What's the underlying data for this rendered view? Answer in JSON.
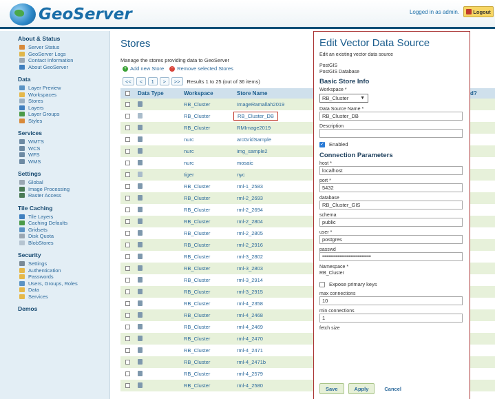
{
  "header": {
    "logo_text": "GeoServer",
    "login_info": "Logged in as admin.",
    "logout_label": "Logout"
  },
  "sidebar": {
    "sections": [
      {
        "title": "About & Status",
        "items": [
          {
            "label": "Server Status",
            "icon": "server-icon",
            "color": "#d88a3a"
          },
          {
            "label": "GeoServer Logs",
            "icon": "logs-icon",
            "color": "#e0b64a"
          },
          {
            "label": "Contact Information",
            "icon": "contact-icon",
            "color": "#9aa7b3"
          },
          {
            "label": "About GeoServer",
            "icon": "info-icon",
            "color": "#3f7fbf"
          }
        ]
      },
      {
        "title": "Data",
        "items": [
          {
            "label": "Layer Preview",
            "icon": "preview-icon",
            "color": "#5a93c4"
          },
          {
            "label": "Workspaces",
            "icon": "folder-icon",
            "color": "#e5b84a"
          },
          {
            "label": "Stores",
            "icon": "store-icon",
            "color": "#9ab0c2"
          },
          {
            "label": "Layers",
            "icon": "layers-icon",
            "color": "#3f7fbf"
          },
          {
            "label": "Layer Groups",
            "icon": "layer-groups-icon",
            "color": "#4a9a48"
          },
          {
            "label": "Styles",
            "icon": "styles-icon",
            "color": "#d88a3a"
          }
        ]
      },
      {
        "title": "Services",
        "items": [
          {
            "label": "WMTS",
            "icon": "wmts-icon",
            "color": "#6d8aa3"
          },
          {
            "label": "WCS",
            "icon": "wcs-icon",
            "color": "#6d8aa3"
          },
          {
            "label": "WFS",
            "icon": "wfs-icon",
            "color": "#6d8aa3"
          },
          {
            "label": "WMS",
            "icon": "wms-icon",
            "color": "#6d8aa3"
          }
        ]
      },
      {
        "title": "Settings",
        "items": [
          {
            "label": "Global",
            "icon": "global-icon",
            "color": "#9aa7b3"
          },
          {
            "label": "Image Processing",
            "icon": "image-processing-icon",
            "color": "#4a7a55"
          },
          {
            "label": "Raster Access",
            "icon": "raster-access-icon",
            "color": "#4a7a55"
          }
        ]
      },
      {
        "title": "Tile Caching",
        "items": [
          {
            "label": "Tile Layers",
            "icon": "tile-layers-icon",
            "color": "#3f7fbf"
          },
          {
            "label": "Caching Defaults",
            "icon": "caching-defaults-icon",
            "color": "#4a9a48"
          },
          {
            "label": "Gridsets",
            "icon": "gridsets-icon",
            "color": "#5a93c4"
          },
          {
            "label": "Disk Quota",
            "icon": "disk-quota-icon",
            "color": "#9aa7b3"
          },
          {
            "label": "BlobStores",
            "icon": "blobstores-icon",
            "color": "#b5c4d1"
          }
        ]
      },
      {
        "title": "Security",
        "items": [
          {
            "label": "Settings",
            "icon": "security-settings-icon",
            "color": "#7a8a96"
          },
          {
            "label": "Authentication",
            "icon": "authentication-icon",
            "color": "#e5b84a"
          },
          {
            "label": "Passwords",
            "icon": "passwords-icon",
            "color": "#e5b84a"
          },
          {
            "label": "Users, Groups, Roles",
            "icon": "users-icon",
            "color": "#5a93c4"
          },
          {
            "label": "Data",
            "icon": "data-security-icon",
            "color": "#e5b84a"
          },
          {
            "label": "Services",
            "icon": "services-security-icon",
            "color": "#e5b84a"
          }
        ]
      },
      {
        "title": "Demos",
        "items": []
      }
    ]
  },
  "stores": {
    "title": "Stores",
    "description": "Manage the stores providing data to GeoServer",
    "add_label": "Add new Store",
    "remove_label": "Remove selected Stores",
    "pager": {
      "first": "<<",
      "prev": "<",
      "page": "1",
      "next": ">",
      "last": ">>",
      "info": "Results 1 to 25 (out of 36 items)"
    },
    "columns": {
      "type": "Data Type",
      "workspace": "Workspace",
      "name": "Store Name"
    },
    "rows": [
      {
        "workspace": "RB_Cluster",
        "name": "ImageRamallah2019",
        "type": "vector"
      },
      {
        "workspace": "RB_Cluster",
        "name": "RB_Cluster_DB",
        "type": "raster"
      },
      {
        "workspace": "RB_Cluster",
        "name": "RMImage2019",
        "type": "vector"
      },
      {
        "workspace": "nurc",
        "name": "arcGridSample",
        "type": "vector"
      },
      {
        "workspace": "nurc",
        "name": "img_sample2",
        "type": "vector"
      },
      {
        "workspace": "nurc",
        "name": "mosaic",
        "type": "vector"
      },
      {
        "workspace": "tiger",
        "name": "nyc",
        "type": "raster"
      },
      {
        "workspace": "RB_Cluster",
        "name": "rml-1_2583",
        "type": "vector"
      },
      {
        "workspace": "RB_Cluster",
        "name": "rml-2_2693",
        "type": "vector"
      },
      {
        "workspace": "RB_Cluster",
        "name": "rml-2_2694",
        "type": "vector"
      },
      {
        "workspace": "RB_Cluster",
        "name": "rml-2_2804",
        "type": "vector"
      },
      {
        "workspace": "RB_Cluster",
        "name": "rml-2_2805",
        "type": "vector"
      },
      {
        "workspace": "RB_Cluster",
        "name": "rml-2_2916",
        "type": "vector"
      },
      {
        "workspace": "RB_Cluster",
        "name": "rml-3_2802",
        "type": "vector"
      },
      {
        "workspace": "RB_Cluster",
        "name": "rml-3_2803",
        "type": "vector"
      },
      {
        "workspace": "RB_Cluster",
        "name": "rml-3_2914",
        "type": "vector"
      },
      {
        "workspace": "RB_Cluster",
        "name": "rml-3_2915",
        "type": "vector"
      },
      {
        "workspace": "RB_Cluster",
        "name": "rml-4_2358",
        "type": "vector"
      },
      {
        "workspace": "RB_Cluster",
        "name": "rml-4_2468",
        "type": "vector"
      },
      {
        "workspace": "RB_Cluster",
        "name": "rml-4_2469",
        "type": "vector"
      },
      {
        "workspace": "RB_Cluster",
        "name": "rml-4_2470",
        "type": "vector"
      },
      {
        "workspace": "RB_Cluster",
        "name": "rml-4_2471",
        "type": "vector"
      },
      {
        "workspace": "RB_Cluster",
        "name": "rml-4_2471b",
        "type": "vector"
      },
      {
        "workspace": "RB_Cluster",
        "name": "rml-4_2579",
        "type": "vector"
      },
      {
        "workspace": "RB_Cluster",
        "name": "rml-4_2580",
        "type": "vector"
      }
    ],
    "right_header_fragment": "d?"
  },
  "edit_panel": {
    "title": "Edit Vector Data Source",
    "subtitle": "Edit an existing vector data source",
    "source_type": "PostGIS",
    "source_desc": "PostGIS Database",
    "basic_title": "Basic Store Info",
    "workspace_label": "Workspace",
    "workspace_value": "RB_Cluster",
    "ds_name_label": "Data Source Name",
    "ds_name_value": "RB_Cluster_DB",
    "description_label": "Description",
    "description_value": "",
    "enabled_label": "Enabled",
    "conn_title": "Connection Parameters",
    "host_label": "host",
    "host_value": "localhost",
    "port_label": "port",
    "port_value": "5432",
    "database_label": "database",
    "database_value": "RB_Cluster_GIS",
    "schema_label": "schema",
    "schema_value": "public",
    "user_label": "user",
    "user_value": "postgres",
    "passwd_label": "passwd",
    "passwd_value": "••••••••••••••••••••••••••••••••••••••••••••",
    "namespace_label": "Namespace",
    "namespace_value": "RB_Cluster",
    "expose_pk_label": "Expose primary keys",
    "max_conn_label": "max connections",
    "max_conn_value": "10",
    "min_conn_label": "min connections",
    "min_conn_value": "1",
    "fetch_size_label": "fetch size",
    "save_label": "Save",
    "apply_label": "Apply",
    "cancel_label": "Cancel",
    "required_mark": "*"
  }
}
